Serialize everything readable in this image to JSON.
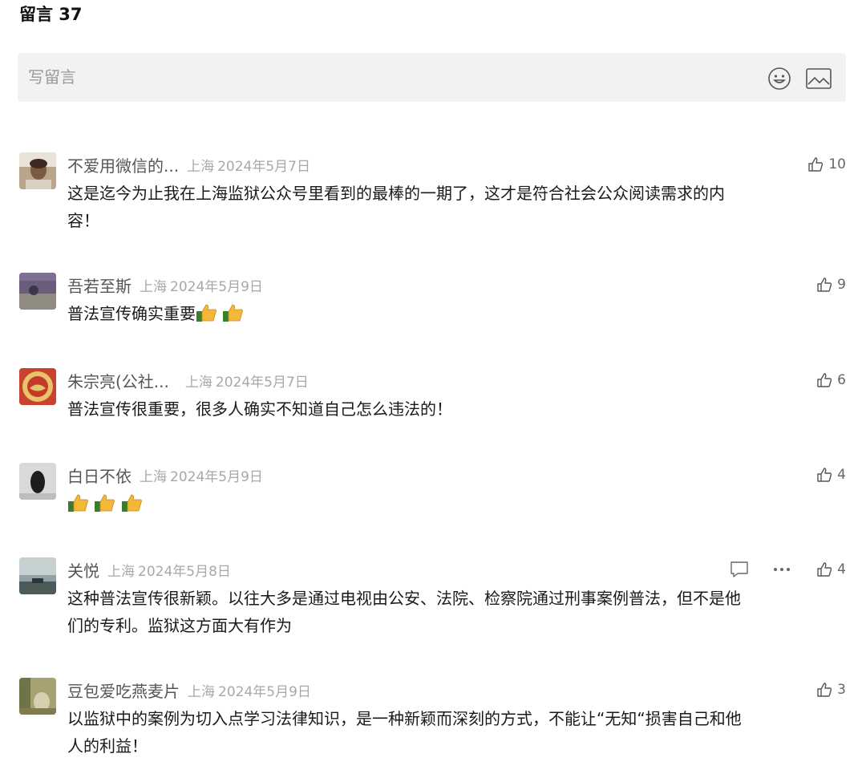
{
  "header": {
    "title": "留言 37"
  },
  "composer": {
    "placeholder": "写留言",
    "emoji_icon": "emoji-smile-icon",
    "image_icon": "image-icon"
  },
  "comments": [
    {
      "nickname": "不爱用微信的...",
      "location": "上海",
      "date": "2024年5月7日",
      "likes": "10",
      "text": "这是迄今为止我在上海监狱公众号里看到的最棒的一期了，这才是符合社会公众阅读需求的内",
      "text2": "容！"
    },
    {
      "nickname": "吾若至斯",
      "location": "上海",
      "date": "2024年5月9日",
      "likes": "9",
      "text": "普法宣传确实重要",
      "emoji": "thumbs-up-emoji x2"
    },
    {
      "nickname": "朱宗亮(公社...",
      "location": "上海",
      "date": "2024年5月7日",
      "likes": "6",
      "text": "普法宣传很重要，很多人确实不知道自己怎么违法的！"
    },
    {
      "nickname": "白日不依",
      "location": "上海",
      "date": "2024年5月9日",
      "likes": "4",
      "emoji": "thumbs-up-emoji x3"
    },
    {
      "nickname": "关悦",
      "location": "上海",
      "date": "2024年5月8日",
      "likes": "4",
      "text": "这种普法宣传很新颖。以往大多是通过电视由公安、法院、检察院通过刑事案例普法，但不是他",
      "text2": "们的专利。监狱这方面大有作为",
      "reply_icon": "reply-icon",
      "more_icon": "more-icon"
    },
    {
      "nickname": "豆包爱吃燕麦片",
      "location": "上海",
      "date": "2024年5月9日",
      "likes": "3",
      "text": "以监狱中的案例为切入点学习法律知识，是一种新颖而深刻的方式，不能让“无知“损害自己和他",
      "text2": "人的利益！"
    }
  ],
  "colors": {
    "placeholder": "#9a9a9a",
    "meta": "#a8a8a8",
    "composer_bg": "#f2f2f2"
  }
}
